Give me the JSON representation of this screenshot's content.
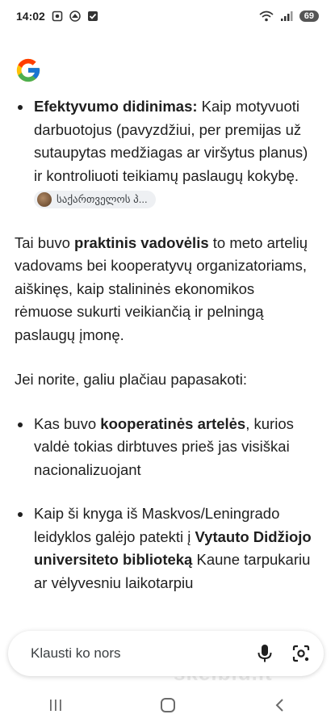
{
  "status_bar": {
    "time": "14:02",
    "battery": "69"
  },
  "content": {
    "bullet1": {
      "bold": "Efektyvumo didinimas:",
      "text": " Kaip motyvuoti darbuotojus (pavyzdžiui, per premijas už sutaupytas medžiagas ar viršytus planus) ir kontroliuoti teikiamų paslaugų kokybę.",
      "source_chip": "საქართველოს პ..."
    },
    "para1": {
      "pre": "Tai buvo ",
      "bold": "praktinis vadovėlis",
      "post": " to meto artelių vadovams bei kooperatyvų organizatoriams, aiškinęs, kaip stalininės ekonomikos rėmuose sukurti veikiančią ir pelningą paslaugų įmonę."
    },
    "para2": "Jei norite, galiu plačiau papasakoti:",
    "bullet2": {
      "pre": "Kas buvo ",
      "bold": "kooperatinės artelės",
      "post": ", kurios valdė tokias dirbtuves prieš jas visiškai nacionalizuojant"
    },
    "bullet3": {
      "pre": "Kaip ši knyga iš Maskvos/Leningrado leidyklos galėjo patekti į ",
      "bold": "Vytauto Didžiojo universiteto biblioteką",
      "post": " Kaune tarpukariu ar vėlyvesniu laikotarpiu"
    }
  },
  "ask_bar": {
    "placeholder": "Klausti ko nors"
  },
  "watermark": "skelbiu.lt",
  "icons": [
    "gallery-icon",
    "vpn-icon",
    "checkbox-icon",
    "wifi-icon",
    "signal-icon",
    "google-logo",
    "mic-icon",
    "lens-icon",
    "recents-icon",
    "home-icon",
    "back-icon"
  ]
}
